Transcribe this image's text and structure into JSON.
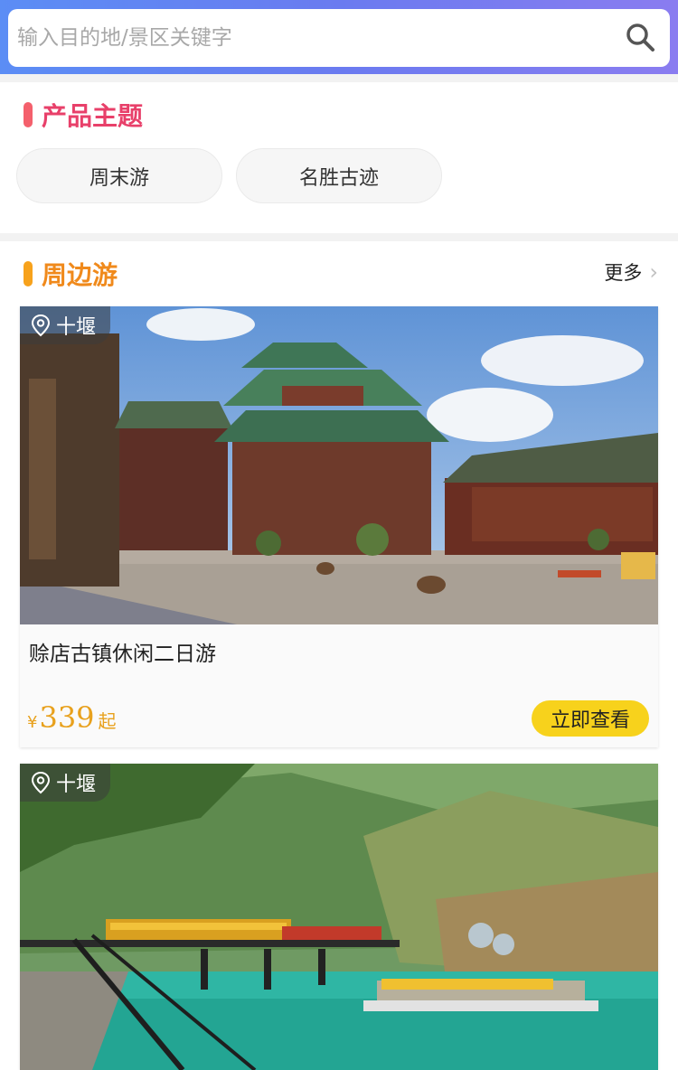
{
  "search": {
    "placeholder": "输入目的地/景区关键字"
  },
  "theme_section": {
    "title": "产品主题",
    "accent": "#f4606c",
    "title_color": "#e8406a",
    "tags": [
      "周末游",
      "名胜古迹"
    ]
  },
  "nearby_section": {
    "title": "周边游",
    "accent": "#f7a21c",
    "title_color": "#f08a1c",
    "more_label": "更多"
  },
  "cards": [
    {
      "location": "十堰",
      "title": "赊店古镇休闲二日游",
      "currency": "¥",
      "price": "339",
      "price_suffix": "起",
      "button_label": "立即查看"
    },
    {
      "location": "十堰"
    }
  ]
}
